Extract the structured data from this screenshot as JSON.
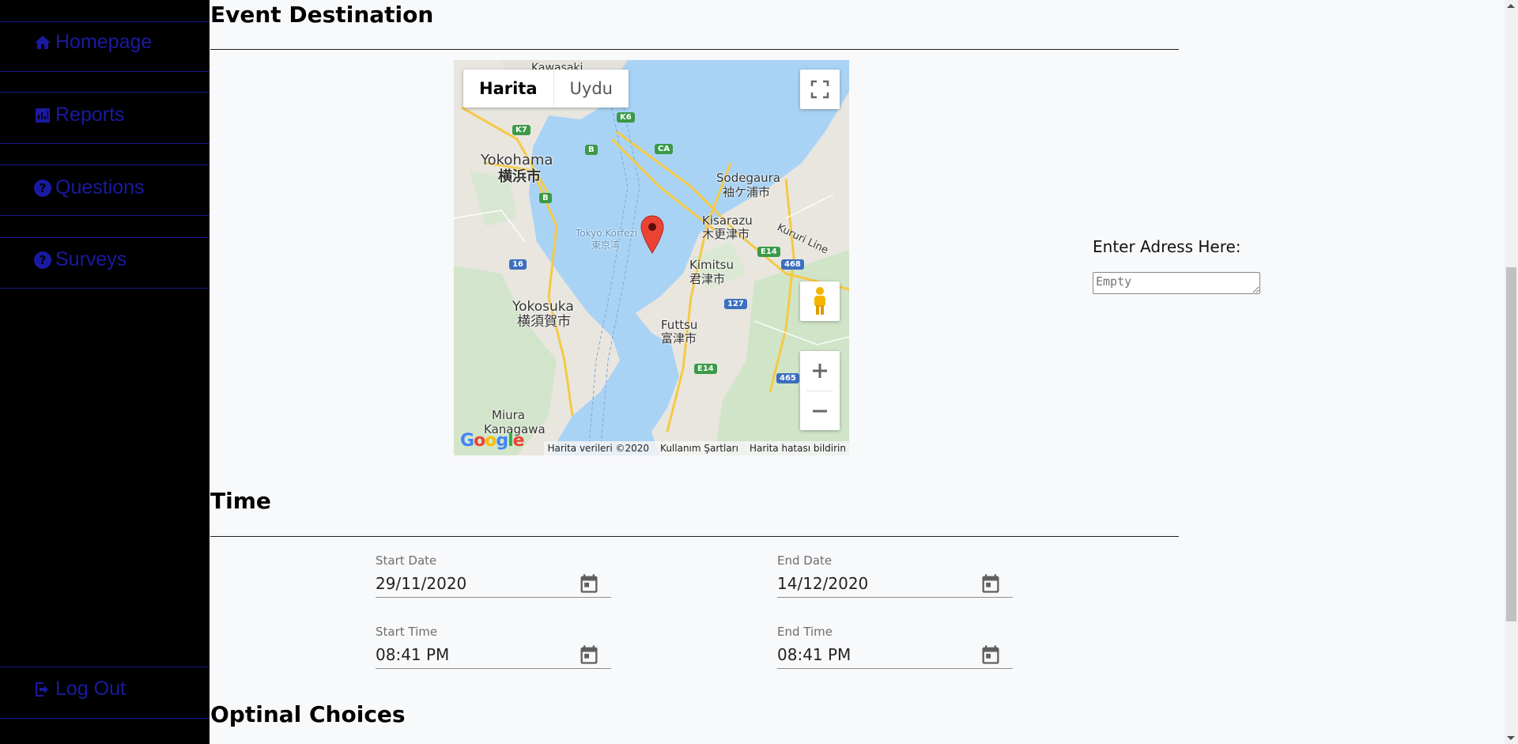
{
  "sidebar": {
    "items": [
      {
        "label": "Homepage",
        "icon": "home-icon"
      },
      {
        "label": "Reports",
        "icon": "bar-chart-icon"
      },
      {
        "label": "Questions",
        "icon": "question-circle-icon"
      },
      {
        "label": "Surveys",
        "icon": "question-circle-icon"
      }
    ],
    "logout": {
      "label": "Log Out",
      "icon": "sign-out-icon"
    },
    "link_color": "#1a1aa0",
    "background": "#000000"
  },
  "sections": {
    "destination_title": "Event Destination",
    "time_title": "Time",
    "optional_title": "Optinal Choices"
  },
  "map": {
    "type_buttons": [
      "Harita",
      "Uydu"
    ],
    "active_type": "Harita",
    "labels": {
      "kawasaki": "Kawasaki",
      "yokohama": "Yokohama",
      "yokohama_jp": "横浜市",
      "sodegaura": "Sodegaura",
      "sodegaura_jp": "袖ケ浦市",
      "kisarazu": "Kisarazu",
      "kisarazu_jp": "木更津市",
      "kururi": "Kururi Line",
      "tokyo_bay": "Tokyo Körfezi",
      "tokyo_bay_jp": "東京湾",
      "kimitsu": "Kimitsu",
      "kimitsu_jp": "君津市",
      "yokosuka": "Yokosuka",
      "yokosuka_jp": "横須賀市",
      "futtsu": "Futtsu",
      "futtsu_jp": "富津市",
      "miura": "Miura",
      "kanagawa": "Kanagawa"
    },
    "shields": [
      "K7",
      "K6",
      "CA",
      "B",
      "B",
      "16",
      "E14",
      "468",
      "127",
      "E14",
      "465"
    ],
    "google_logo": "Google",
    "attribution": [
      "Harita verileri ©2020",
      "Kullanım Şartları",
      "Harita hatası bildirin"
    ],
    "marker_color": "#ea4335"
  },
  "address": {
    "label": "Enter Adress Here:",
    "placeholder": "Empty",
    "value": ""
  },
  "time": {
    "start_date": {
      "label": "Start Date",
      "value": "29/11/2020"
    },
    "end_date": {
      "label": "End Date",
      "value": "14/12/2020"
    },
    "start_time": {
      "label": "Start Time",
      "value": "08:41 PM"
    },
    "end_time": {
      "label": "End Time",
      "value": "08:41 PM"
    }
  }
}
